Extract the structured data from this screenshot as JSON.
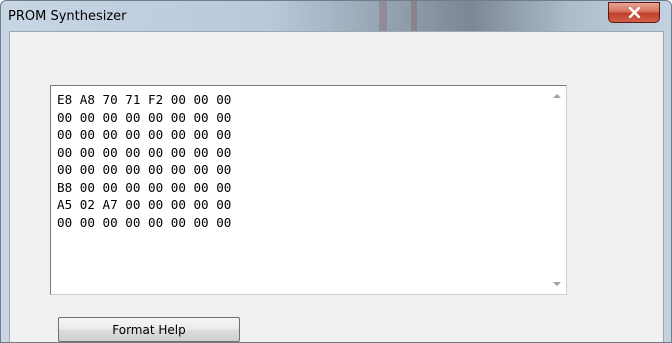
{
  "window": {
    "title": "PROM Synthesizer"
  },
  "editor": {
    "lines": [
      "E8 A8 70 71 F2 00 00 00",
      "00 00 00 00 00 00 00 00",
      "00 00 00 00 00 00 00 00",
      "00 00 00 00 00 00 00 00",
      "00 00 00 00 00 00 00 00",
      "B8 00 00 00 00 00 00 00",
      "A5 02 A7 00 00 00 00 00",
      "00 00 00 00 00 00 00 00"
    ]
  },
  "buttons": {
    "format_help_label": "Format Help"
  },
  "icons": {
    "close": "close-x-icon",
    "scroll_up": "scroll-up-arrow-icon",
    "scroll_down": "scroll-down-arrow-icon"
  },
  "colors": {
    "close_button": "#c9503a",
    "client_background": "#f0f0f0"
  }
}
